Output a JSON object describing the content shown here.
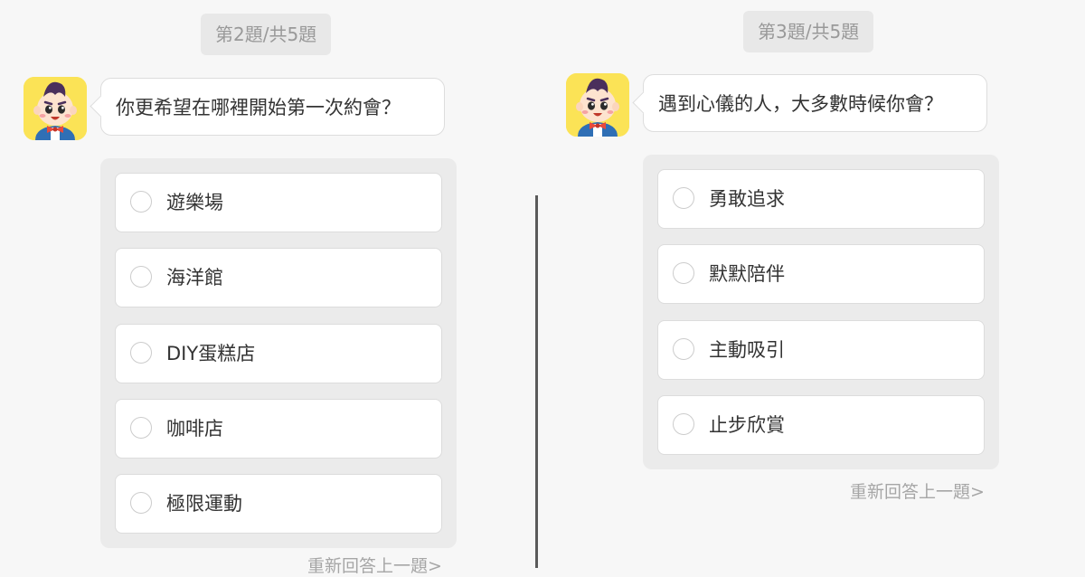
{
  "left_panel": {
    "progress_badge": "第2題/共5題",
    "question": "你更希望在哪裡開始第一次約會？",
    "options": [
      {
        "label": "遊樂場"
      },
      {
        "label": "海洋館"
      },
      {
        "label": "DIY蛋糕店"
      },
      {
        "label": "咖啡店"
      },
      {
        "label": "極限運動"
      }
    ],
    "redo_link": "重新回答上一題>"
  },
  "right_panel": {
    "progress_badge": "第3題/共5題",
    "question": "遇到心儀的人，大多數時候你會？",
    "options": [
      {
        "label": "勇敢追求"
      },
      {
        "label": "默默陪伴"
      },
      {
        "label": "主動吸引"
      },
      {
        "label": "止步欣賞"
      }
    ],
    "redo_link": "重新回答上一題>"
  },
  "colors": {
    "page_background": "#f7f7f7",
    "badge_background": "#e8e8e8",
    "options_background": "#ebebeb",
    "avatar_background": "#fbe356",
    "mascot_bowtie": "#e84a3c",
    "mascot_overalls": "#2f6fb5"
  },
  "icons": {
    "avatar": "mascot-boy-avatar-icon",
    "radio": "radio-circle-icon"
  }
}
